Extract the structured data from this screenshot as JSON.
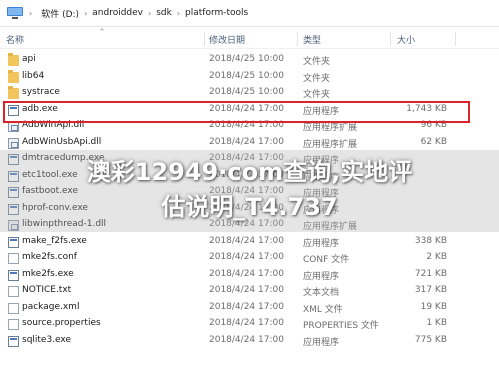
{
  "breadcrumb": [
    "软件 (D:)",
    "androiddev",
    "sdk",
    "platform-tools"
  ],
  "columns": {
    "name": "名称",
    "date": "修改日期",
    "type": "类型",
    "size": "大小"
  },
  "files": [
    {
      "name": "api",
      "date": "2018/4/25 10:00",
      "type": "文件夹",
      "size": "",
      "icon": "folder-icon"
    },
    {
      "name": "lib64",
      "date": "2018/4/25 10:00",
      "type": "文件夹",
      "size": "",
      "icon": "folder-icon"
    },
    {
      "name": "systrace",
      "date": "2018/4/25 10:00",
      "type": "文件夹",
      "size": "",
      "icon": "folder-icon"
    },
    {
      "name": "adb.exe",
      "date": "2018/4/24 17:00",
      "type": "应用程序",
      "size": "1,743 KB",
      "icon": "exe-icon"
    },
    {
      "name": "AdbWinApi.dll",
      "date": "2018/4/24 17:00",
      "type": "应用程序扩展",
      "size": "96 KB",
      "icon": "dll-icon"
    },
    {
      "name": "AdbWinUsbApi.dll",
      "date": "2018/4/24 17:00",
      "type": "应用程序扩展",
      "size": "62 KB",
      "icon": "dll-icon"
    },
    {
      "name": "dmtracedump.exe",
      "date": "2018/4/24 17:00",
      "type": "应用程序",
      "size": "",
      "icon": "exe-icon"
    },
    {
      "name": "etc1tool.exe",
      "date": "2018/4/24 17:00",
      "type": "应用程序",
      "size": "",
      "icon": "exe-icon"
    },
    {
      "name": "fastboot.exe",
      "date": "2018/4/24 17:00",
      "type": "应用程序",
      "size": "",
      "icon": "exe-icon"
    },
    {
      "name": "hprof-conv.exe",
      "date": "2018/4/24 17:00",
      "type": "应用程序",
      "size": "",
      "icon": "exe-icon"
    },
    {
      "name": "libwinpthread-1.dll",
      "date": "2018/4/24 17:00",
      "type": "应用程序扩展",
      "size": "",
      "icon": "dll-icon"
    },
    {
      "name": "make_f2fs.exe",
      "date": "2018/4/24 17:00",
      "type": "应用程序",
      "size": "338 KB",
      "icon": "exe-icon"
    },
    {
      "name": "mke2fs.conf",
      "date": "2018/4/24 17:00",
      "type": "CONF 文件",
      "size": "2 KB",
      "icon": "file-icon"
    },
    {
      "name": "mke2fs.exe",
      "date": "2018/4/24 17:00",
      "type": "应用程序",
      "size": "721 KB",
      "icon": "exe-icon"
    },
    {
      "name": "NOTICE.txt",
      "date": "2018/4/24 17:00",
      "type": "文本文档",
      "size": "317 KB",
      "icon": "file-icon"
    },
    {
      "name": "package.xml",
      "date": "2018/4/24 17:00",
      "type": "XML 文件",
      "size": "19 KB",
      "icon": "file-icon"
    },
    {
      "name": "source.properties",
      "date": "2018/4/24 17:00",
      "type": "PROPERTIES 文件",
      "size": "1 KB",
      "icon": "file-icon"
    },
    {
      "name": "sqlite3.exe",
      "date": "2018/4/24 17:00",
      "type": "应用程序",
      "size": "775 KB",
      "icon": "exe-icon"
    }
  ],
  "watermark": {
    "line1": "澳彩12949·com查询,实地评",
    "line2": "估说明_T4.737"
  },
  "colors": {
    "highlight": "#d9252a",
    "folder": "#f2c55c",
    "header_text": "#4c607a"
  }
}
